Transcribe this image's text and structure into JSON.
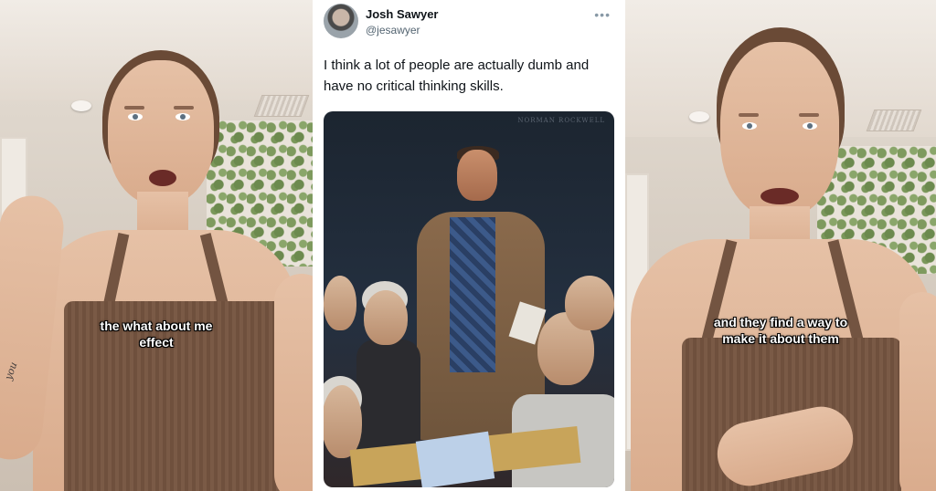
{
  "left_panel": {
    "caption_line1": "the what about me",
    "caption_line2": "effect",
    "tattoo_text": "you"
  },
  "tweet": {
    "display_name": "Josh Sawyer",
    "handle": "@jesawyer",
    "more_icon": "more-horizontal-icon",
    "text": "I think a lot of people are actually dumb and have no critical thinking skills.",
    "image_signature": "NORMAN ROCKWELL"
  },
  "right_panel": {
    "caption_line1": "and they find a way to",
    "caption_line2": "make it about them"
  }
}
